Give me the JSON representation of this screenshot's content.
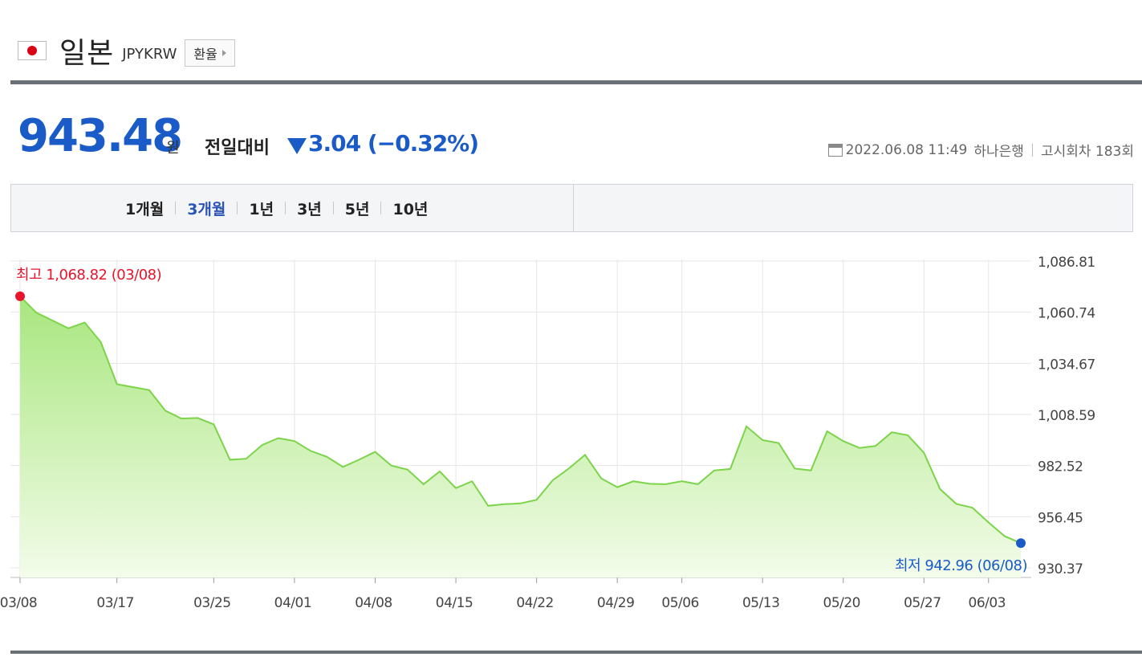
{
  "header": {
    "country": "일본",
    "code": "JPYKRW",
    "exchange_button": "환율"
  },
  "price": {
    "value": "943.48",
    "unit": "원",
    "compare_label": "전일대비",
    "change": "3.04",
    "change_pct": "(−0.32%)",
    "direction": "down"
  },
  "meta": {
    "datetime": "2022.06.08 11:49",
    "bank": "하나은행",
    "notice": "고시회차 183회"
  },
  "tabs": [
    "1개월",
    "3개월",
    "1년",
    "3년",
    "5년",
    "10년"
  ],
  "active_tab": "3개월",
  "colors": {
    "blue": "#1a5bc7",
    "red": "#e8142c",
    "line": "#7cd44a",
    "fill_top": "#a8e67e",
    "fill_bottom": "#f3fcea"
  },
  "chart_data": {
    "type": "area",
    "ylim": [
      930.37,
      1086.81
    ],
    "yticks": [
      "1,086.81",
      "1,060.74",
      "1,034.67",
      "1,008.59",
      "982.52",
      "956.45",
      "930.37"
    ],
    "ytick_values": [
      1086.81,
      1060.74,
      1034.67,
      1008.59,
      982.52,
      956.45,
      930.37
    ],
    "xtick_labels": [
      "03/08",
      "03/17",
      "03/25",
      "04/01",
      "04/08",
      "04/15",
      "04/22",
      "04/29",
      "05/06",
      "05/13",
      "05/20",
      "05/27",
      "06/03"
    ],
    "xtick_index": [
      0,
      6,
      12,
      17,
      22,
      27,
      32,
      37,
      41,
      46,
      51,
      56,
      60
    ],
    "values": [
      1068.82,
      1060.5,
      1056.5,
      1052.5,
      1055.5,
      1045.5,
      1024.0,
      1022.5,
      1021.0,
      1010.5,
      1006.5,
      1006.8,
      1003.5,
      985.5,
      986.0,
      993.0,
      996.5,
      995.0,
      990.0,
      987.0,
      981.8,
      985.5,
      989.5,
      982.5,
      980.5,
      973.0,
      979.5,
      971.0,
      974.5,
      962.0,
      962.8,
      963.2,
      965.0,
      975.0,
      981.0,
      988.0,
      976.0,
      971.5,
      974.5,
      973.2,
      973.0,
      974.5,
      973.0,
      980.0,
      980.8,
      1002.5,
      995.5,
      994.0,
      981.0,
      980.0,
      1000.0,
      995.0,
      991.5,
      992.5,
      999.5,
      998.0,
      989.0,
      970.5,
      963.0,
      961.0,
      953.5,
      946.5,
      942.96
    ],
    "high": {
      "label": "최고",
      "value": "1,068.82",
      "date": "(03/08)"
    },
    "low": {
      "label": "최저",
      "value": "942.96",
      "date": "(06/08)"
    }
  }
}
